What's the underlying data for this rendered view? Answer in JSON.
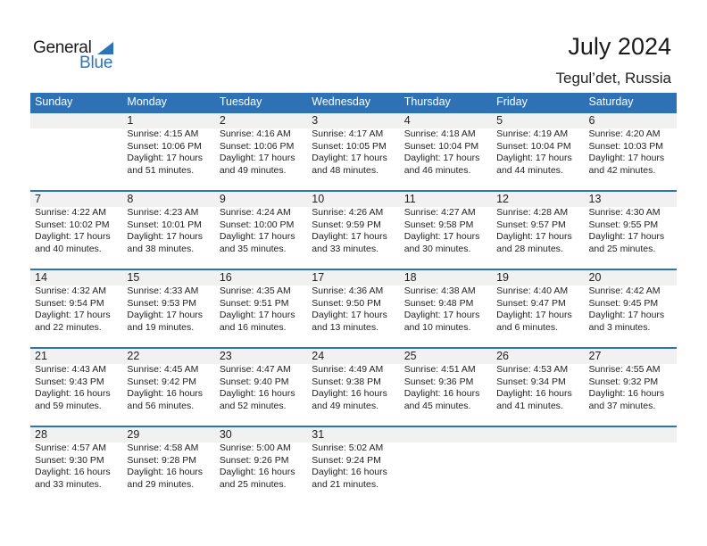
{
  "logo": {
    "general": "General",
    "blue": "Blue"
  },
  "header": {
    "title": "July 2024",
    "location": "Tegul’det, Russia"
  },
  "colors": {
    "accent": "#2e72b5",
    "band": "#f1f1f1"
  },
  "weekdays": [
    "Sunday",
    "Monday",
    "Tuesday",
    "Wednesday",
    "Thursday",
    "Friday",
    "Saturday"
  ],
  "weeks": [
    [
      null,
      {
        "day": "1",
        "sunrise": "Sunrise: 4:15 AM",
        "sunset": "Sunset: 10:06 PM",
        "daylight": "Daylight: 17 hours",
        "minutes": "and 51 minutes."
      },
      {
        "day": "2",
        "sunrise": "Sunrise: 4:16 AM",
        "sunset": "Sunset: 10:06 PM",
        "daylight": "Daylight: 17 hours",
        "minutes": "and 49 minutes."
      },
      {
        "day": "3",
        "sunrise": "Sunrise: 4:17 AM",
        "sunset": "Sunset: 10:05 PM",
        "daylight": "Daylight: 17 hours",
        "minutes": "and 48 minutes."
      },
      {
        "day": "4",
        "sunrise": "Sunrise: 4:18 AM",
        "sunset": "Sunset: 10:04 PM",
        "daylight": "Daylight: 17 hours",
        "minutes": "and 46 minutes."
      },
      {
        "day": "5",
        "sunrise": "Sunrise: 4:19 AM",
        "sunset": "Sunset: 10:04 PM",
        "daylight": "Daylight: 17 hours",
        "minutes": "and 44 minutes."
      },
      {
        "day": "6",
        "sunrise": "Sunrise: 4:20 AM",
        "sunset": "Sunset: 10:03 PM",
        "daylight": "Daylight: 17 hours",
        "minutes": "and 42 minutes."
      }
    ],
    [
      {
        "day": "7",
        "sunrise": "Sunrise: 4:22 AM",
        "sunset": "Sunset: 10:02 PM",
        "daylight": "Daylight: 17 hours",
        "minutes": "and 40 minutes."
      },
      {
        "day": "8",
        "sunrise": "Sunrise: 4:23 AM",
        "sunset": "Sunset: 10:01 PM",
        "daylight": "Daylight: 17 hours",
        "minutes": "and 38 minutes."
      },
      {
        "day": "9",
        "sunrise": "Sunrise: 4:24 AM",
        "sunset": "Sunset: 10:00 PM",
        "daylight": "Daylight: 17 hours",
        "minutes": "and 35 minutes."
      },
      {
        "day": "10",
        "sunrise": "Sunrise: 4:26 AM",
        "sunset": "Sunset: 9:59 PM",
        "daylight": "Daylight: 17 hours",
        "minutes": "and 33 minutes."
      },
      {
        "day": "11",
        "sunrise": "Sunrise: 4:27 AM",
        "sunset": "Sunset: 9:58 PM",
        "daylight": "Daylight: 17 hours",
        "minutes": "and 30 minutes."
      },
      {
        "day": "12",
        "sunrise": "Sunrise: 4:28 AM",
        "sunset": "Sunset: 9:57 PM",
        "daylight": "Daylight: 17 hours",
        "minutes": "and 28 minutes."
      },
      {
        "day": "13",
        "sunrise": "Sunrise: 4:30 AM",
        "sunset": "Sunset: 9:55 PM",
        "daylight": "Daylight: 17 hours",
        "minutes": "and 25 minutes."
      }
    ],
    [
      {
        "day": "14",
        "sunrise": "Sunrise: 4:32 AM",
        "sunset": "Sunset: 9:54 PM",
        "daylight": "Daylight: 17 hours",
        "minutes": "and 22 minutes."
      },
      {
        "day": "15",
        "sunrise": "Sunrise: 4:33 AM",
        "sunset": "Sunset: 9:53 PM",
        "daylight": "Daylight: 17 hours",
        "minutes": "and 19 minutes."
      },
      {
        "day": "16",
        "sunrise": "Sunrise: 4:35 AM",
        "sunset": "Sunset: 9:51 PM",
        "daylight": "Daylight: 17 hours",
        "minutes": "and 16 minutes."
      },
      {
        "day": "17",
        "sunrise": "Sunrise: 4:36 AM",
        "sunset": "Sunset: 9:50 PM",
        "daylight": "Daylight: 17 hours",
        "minutes": "and 13 minutes."
      },
      {
        "day": "18",
        "sunrise": "Sunrise: 4:38 AM",
        "sunset": "Sunset: 9:48 PM",
        "daylight": "Daylight: 17 hours",
        "minutes": "and 10 minutes."
      },
      {
        "day": "19",
        "sunrise": "Sunrise: 4:40 AM",
        "sunset": "Sunset: 9:47 PM",
        "daylight": "Daylight: 17 hours",
        "minutes": "and 6 minutes."
      },
      {
        "day": "20",
        "sunrise": "Sunrise: 4:42 AM",
        "sunset": "Sunset: 9:45 PM",
        "daylight": "Daylight: 17 hours",
        "minutes": "and 3 minutes."
      }
    ],
    [
      {
        "day": "21",
        "sunrise": "Sunrise: 4:43 AM",
        "sunset": "Sunset: 9:43 PM",
        "daylight": "Daylight: 16 hours",
        "minutes": "and 59 minutes."
      },
      {
        "day": "22",
        "sunrise": "Sunrise: 4:45 AM",
        "sunset": "Sunset: 9:42 PM",
        "daylight": "Daylight: 16 hours",
        "minutes": "and 56 minutes."
      },
      {
        "day": "23",
        "sunrise": "Sunrise: 4:47 AM",
        "sunset": "Sunset: 9:40 PM",
        "daylight": "Daylight: 16 hours",
        "minutes": "and 52 minutes."
      },
      {
        "day": "24",
        "sunrise": "Sunrise: 4:49 AM",
        "sunset": "Sunset: 9:38 PM",
        "daylight": "Daylight: 16 hours",
        "minutes": "and 49 minutes."
      },
      {
        "day": "25",
        "sunrise": "Sunrise: 4:51 AM",
        "sunset": "Sunset: 9:36 PM",
        "daylight": "Daylight: 16 hours",
        "minutes": "and 45 minutes."
      },
      {
        "day": "26",
        "sunrise": "Sunrise: 4:53 AM",
        "sunset": "Sunset: 9:34 PM",
        "daylight": "Daylight: 16 hours",
        "minutes": "and 41 minutes."
      },
      {
        "day": "27",
        "sunrise": "Sunrise: 4:55 AM",
        "sunset": "Sunset: 9:32 PM",
        "daylight": "Daylight: 16 hours",
        "minutes": "and 37 minutes."
      }
    ],
    [
      {
        "day": "28",
        "sunrise": "Sunrise: 4:57 AM",
        "sunset": "Sunset: 9:30 PM",
        "daylight": "Daylight: 16 hours",
        "minutes": "and 33 minutes."
      },
      {
        "day": "29",
        "sunrise": "Sunrise: 4:58 AM",
        "sunset": "Sunset: 9:28 PM",
        "daylight": "Daylight: 16 hours",
        "minutes": "and 29 minutes."
      },
      {
        "day": "30",
        "sunrise": "Sunrise: 5:00 AM",
        "sunset": "Sunset: 9:26 PM",
        "daylight": "Daylight: 16 hours",
        "minutes": "and 25 minutes."
      },
      {
        "day": "31",
        "sunrise": "Sunrise: 5:02 AM",
        "sunset": "Sunset: 9:24 PM",
        "daylight": "Daylight: 16 hours",
        "minutes": "and 21 minutes."
      },
      null,
      null,
      null
    ]
  ]
}
